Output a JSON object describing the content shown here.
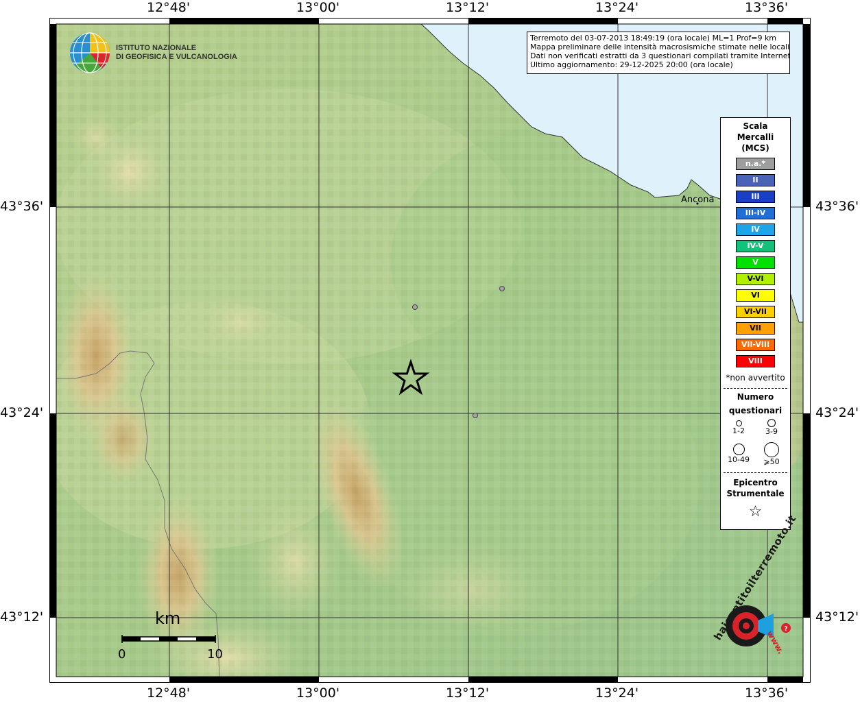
{
  "info": {
    "line1": "Terremoto del 03-07-2013 18:49:19 (ora locale) ML=1 Prof=9 km",
    "line2": "Mappa preliminare delle intensità macrosismiche stimate nelle località",
    "line3": "Dati non verificati estratti da 3 questionari compilati tramite Internet.",
    "line4": "Ultimo aggiornamento: 29-12-2025 20:00 (ora locale)"
  },
  "logo": {
    "line1": "ISTITUTO NAZIONALE",
    "line2": "DI GEOFISICA E VULCANOLOGIA"
  },
  "axes": {
    "top": [
      "12°48'",
      "13°00'",
      "13°12'",
      "13°24'",
      "13°36'"
    ],
    "bottom": [
      "12°48'",
      "13°00'",
      "13°12'",
      "13°24'",
      "13°36'"
    ],
    "left": [
      "43°36'",
      "43°24'",
      "43°12'"
    ],
    "right": [
      "43°36'",
      "43°24'",
      "43°12'"
    ]
  },
  "city": {
    "name": "Ancona"
  },
  "legend": {
    "title_line1": "Scala",
    "title_line2": "Mercalli",
    "title_line3": "(MCS)",
    "mcs": [
      {
        "label": "n.a.*",
        "color": "#9e9e9e"
      },
      {
        "label": "II",
        "color": "#4a62b8"
      },
      {
        "label": "III",
        "color": "#1a3fc4"
      },
      {
        "label": "III-IV",
        "color": "#1f6fd6"
      },
      {
        "label": "IV",
        "color": "#1ea4e8"
      },
      {
        "label": "IV-V",
        "color": "#12c27a"
      },
      {
        "label": "V",
        "color": "#00e000"
      },
      {
        "label": "V-VI",
        "color": "#b0f000"
      },
      {
        "label": "VI",
        "color": "#ffff00"
      },
      {
        "label": "VI-VII",
        "color": "#ffd000"
      },
      {
        "label": "VII",
        "color": "#ffa000"
      },
      {
        "label": "VII-VIII",
        "color": "#ff6a00"
      },
      {
        "label": "VIII",
        "color": "#ff0000"
      }
    ],
    "note": "*non avvertito",
    "questionari_line1": "Numero",
    "questionari_line2": "questionari",
    "q_labels": [
      "1-2",
      "3-9",
      "10-49",
      "⩾50"
    ],
    "epicentro_line1": "Epicentro",
    "epicentro_line2": "Strumentale"
  },
  "scalebar": {
    "title": "km",
    "min": "0",
    "max": "10"
  },
  "brand": {
    "site": "haisentitoilterremoto.it",
    "www": "www."
  }
}
